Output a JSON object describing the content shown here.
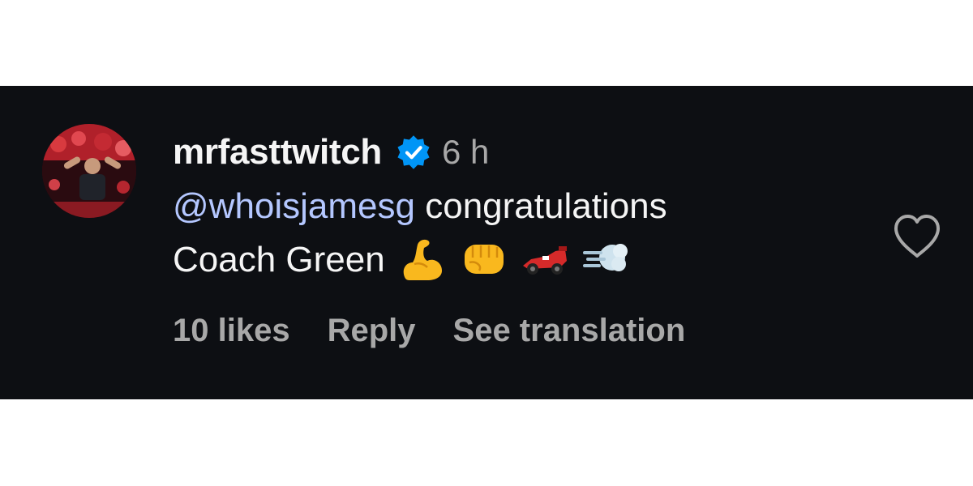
{
  "comment": {
    "username": "mrfasttwitch",
    "verified": true,
    "timestamp": "6 h",
    "mention": "@whoisjamesg",
    "text_after_mention": " congratulations",
    "text_line2": "Coach Green",
    "emojis": [
      "flexed-biceps",
      "oncoming-fist",
      "racing-car",
      "dashing-away"
    ],
    "likes_label": "10 likes",
    "reply_label": "Reply",
    "see_translation_label": "See translation"
  },
  "colors": {
    "background": "#0d0f13",
    "primary_text": "#f5f5f5",
    "secondary_text": "#a8a8a8",
    "mention": "#b4c7ff",
    "verified_badge": "#0095f6"
  }
}
